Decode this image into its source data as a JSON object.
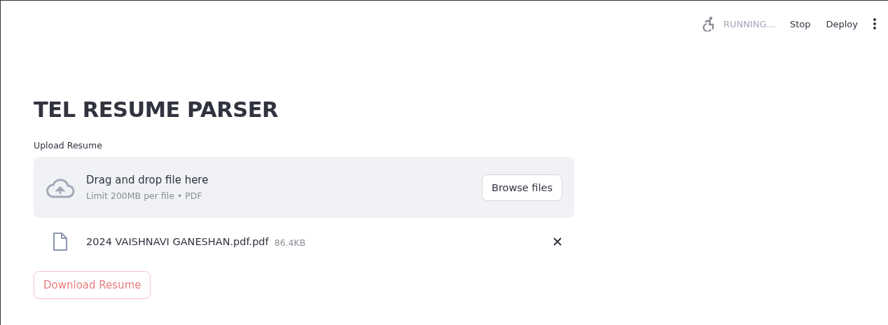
{
  "header": {
    "status": "RUNNING...",
    "running": true,
    "buttons": [
      "Stop",
      "Deploy"
    ]
  },
  "title": "TEL RESUME PARSER",
  "uploader": {
    "label": "Upload Resume",
    "instructions": "Drag and drop file here",
    "limits": "Limit 200MB per file • PDF",
    "button": "Browse files"
  },
  "files": [
    {
      "name": "2024 VAISHNAVI GANESHAN.pdf.pdf",
      "size": "86.4KB"
    }
  ],
  "download_button": {
    "label": "Download Resume",
    "disabled": true
  }
}
